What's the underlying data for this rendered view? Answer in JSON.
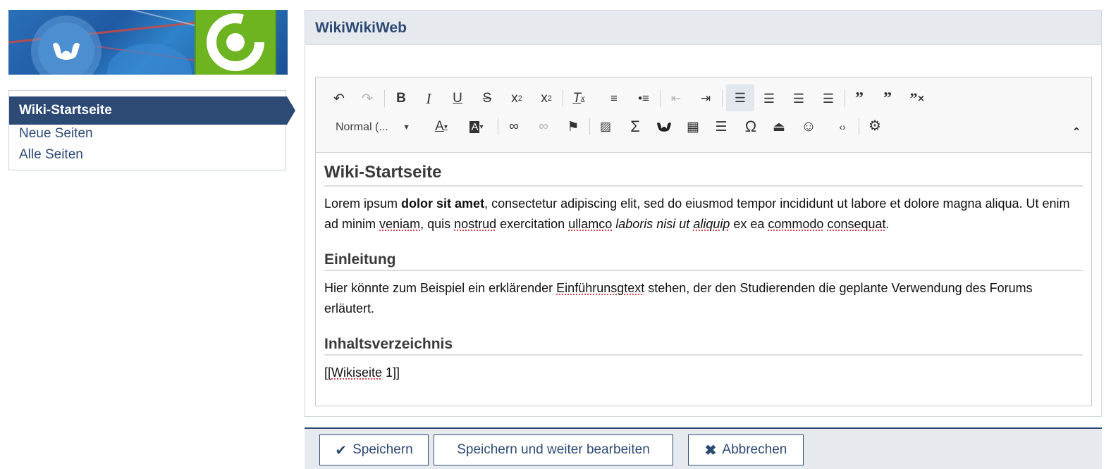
{
  "sidebar": {
    "items": [
      {
        "label": "Wiki-Startseite",
        "active": true
      },
      {
        "label": "Neue Seiten"
      },
      {
        "label": "Alle Seiten"
      }
    ]
  },
  "panel": {
    "title": "WikiWikiWeb"
  },
  "toolbar": {
    "format_value": "Normal (...",
    "buttons_row1": [
      "undo-icon",
      "redo-icon",
      "bold-icon",
      "italic-icon",
      "underline-icon",
      "strike-icon",
      "subscript-icon",
      "superscript-icon",
      "remove-format-icon",
      "numbered-list-icon",
      "bulleted-list-icon",
      "outdent-icon",
      "indent-icon",
      "align-left-icon",
      "align-center-icon",
      "align-right-icon",
      "justify-icon",
      "blockquote-icon",
      "blockquote-split-icon",
      "blockquote-remove-icon"
    ],
    "buttons_row2": [
      "text-color-icon",
      "background-color-icon",
      "link-icon",
      "unlink-icon",
      "anchor-flag-icon",
      "image-icon",
      "sigma-icon",
      "ilias-logo-icon",
      "table-icon",
      "horizontal-rule-icon",
      "omega-icon",
      "page-break-icon",
      "smiley-icon",
      "source-icon",
      "settings-gears-icon",
      "collapse-toolbar-icon"
    ]
  },
  "content": {
    "heading": "Wiki-Startseite",
    "p1": {
      "a": "Lorem ipsum ",
      "bold": "dolor sit amet",
      "b": ", consectetur adipiscing elit, sed do eiusmod tempor incididunt ut labore et dolore magna aliqua. Ut enim ad minim ",
      "w1": "veniam",
      "c": ", quis ",
      "w2": "nostrud",
      "d": " exercitation ",
      "w3": "ullamco",
      "e": " ",
      "italic1": "laboris nisi ut ",
      "italic2": "aliquip",
      "f": " ex ea ",
      "w4": "commodo",
      "g": " ",
      "w5": "consequat",
      "h": "."
    },
    "h2a": "Einleitung",
    "p2": {
      "a": "Hier könnte zum Beispiel ein erklärender ",
      "w1": "Einführunsgtext",
      "b": " stehen, der den Studierenden die geplante Verwendung des Forums erläutert."
    },
    "h2b": "Inhaltsverzeichnis",
    "p3": {
      "a": "[[",
      "w1": "Wikiseite",
      "b": " 1]]"
    }
  },
  "footer": {
    "save": "Speichern",
    "save_continue": "Speichern und weiter bearbeiten",
    "cancel": "Abbrechen"
  },
  "colors": {
    "brand": "#2c4a74",
    "green": "#6db420"
  }
}
